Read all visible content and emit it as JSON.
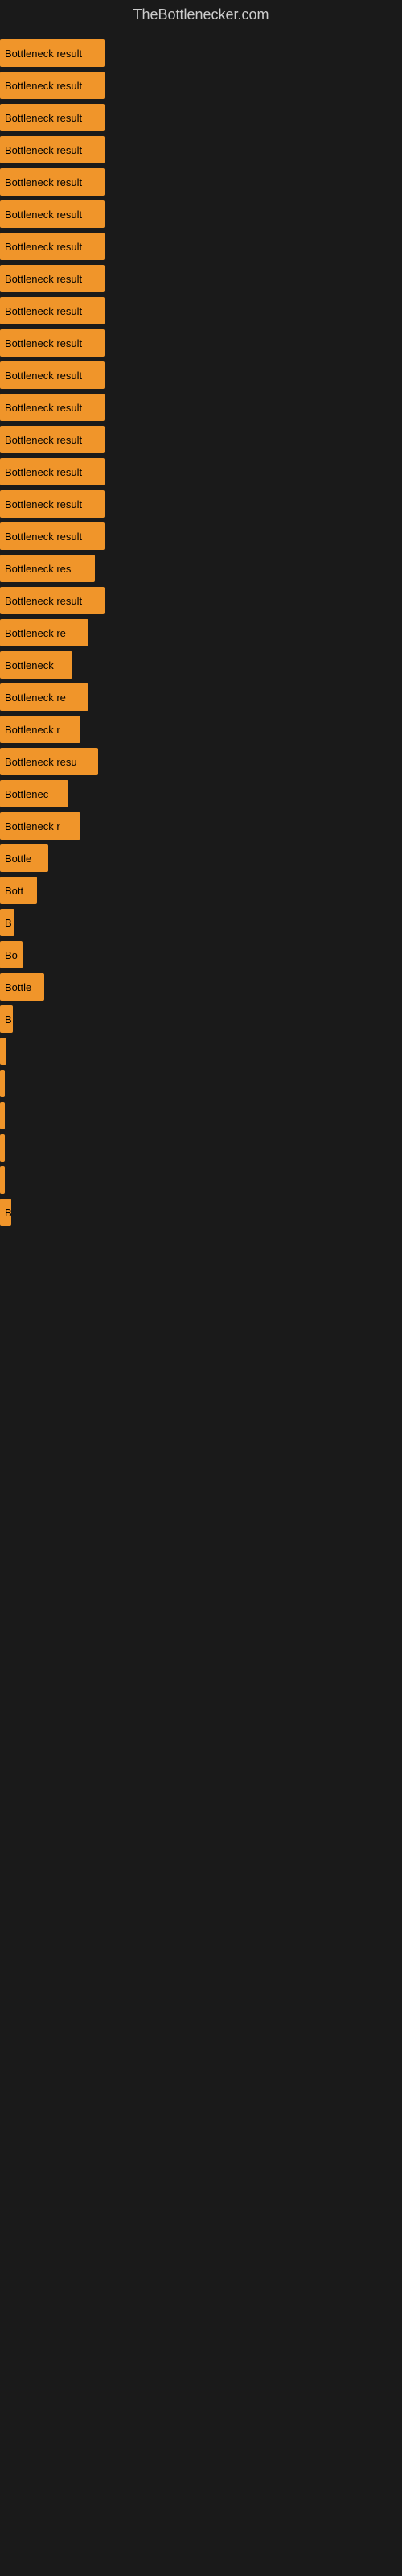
{
  "site": {
    "title": "TheBottlenecker.com"
  },
  "bars": [
    {
      "label": "Bottleneck result",
      "width": 130
    },
    {
      "label": "Bottleneck result",
      "width": 130
    },
    {
      "label": "Bottleneck result",
      "width": 130
    },
    {
      "label": "Bottleneck result",
      "width": 130
    },
    {
      "label": "Bottleneck result",
      "width": 130
    },
    {
      "label": "Bottleneck result",
      "width": 130
    },
    {
      "label": "Bottleneck result",
      "width": 130
    },
    {
      "label": "Bottleneck result",
      "width": 130
    },
    {
      "label": "Bottleneck result",
      "width": 130
    },
    {
      "label": "Bottleneck result",
      "width": 130
    },
    {
      "label": "Bottleneck result",
      "width": 130
    },
    {
      "label": "Bottleneck result",
      "width": 130
    },
    {
      "label": "Bottleneck result",
      "width": 130
    },
    {
      "label": "Bottleneck result",
      "width": 130
    },
    {
      "label": "Bottleneck result",
      "width": 130
    },
    {
      "label": "Bottleneck result",
      "width": 130
    },
    {
      "label": "Bottleneck res",
      "width": 118
    },
    {
      "label": "Bottleneck result",
      "width": 130
    },
    {
      "label": "Bottleneck re",
      "width": 110
    },
    {
      "label": "Bottleneck",
      "width": 90
    },
    {
      "label": "Bottleneck re",
      "width": 110
    },
    {
      "label": "Bottleneck r",
      "width": 100
    },
    {
      "label": "Bottleneck resu",
      "width": 122
    },
    {
      "label": "Bottlenec",
      "width": 85
    },
    {
      "label": "Bottleneck r",
      "width": 100
    },
    {
      "label": "Bottle",
      "width": 60
    },
    {
      "label": "Bott",
      "width": 46
    },
    {
      "label": "B",
      "width": 18
    },
    {
      "label": "Bo",
      "width": 28
    },
    {
      "label": "Bottle",
      "width": 55
    },
    {
      "label": "B",
      "width": 16
    },
    {
      "label": "",
      "width": 8
    },
    {
      "label": "",
      "width": 4
    },
    {
      "label": "",
      "width": 4
    },
    {
      "label": "",
      "width": 4
    },
    {
      "label": "",
      "width": 4
    },
    {
      "label": "B",
      "width": 14
    }
  ]
}
